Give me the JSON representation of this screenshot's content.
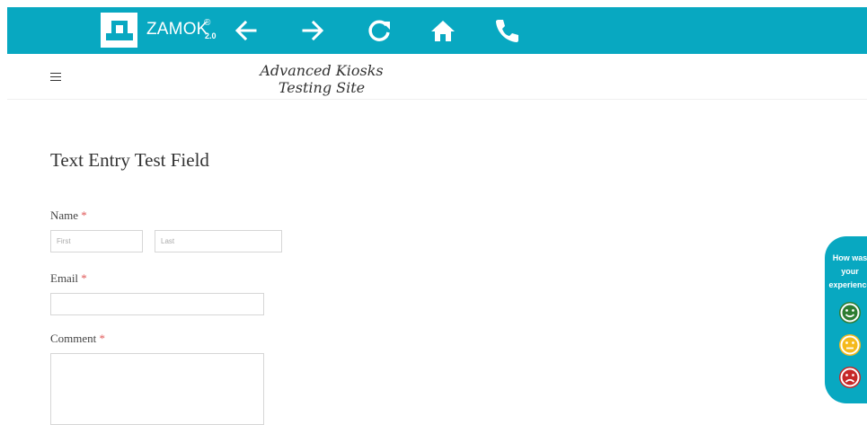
{
  "toolbar": {
    "brand": "ZAMOK",
    "registered": "®",
    "version": "2.0",
    "icons": [
      "back-arrow-icon",
      "forward-arrow-icon",
      "reload-icon",
      "home-icon",
      "phone-icon"
    ],
    "color": "#08a8c1"
  },
  "header": {
    "title_line1": "Advanced Kiosks",
    "title_line2": "Testing Site",
    "menu_icon": "hamburger-menu-icon"
  },
  "form": {
    "heading": "Text Entry Test Field",
    "name_label": "Name",
    "first_placeholder": "First",
    "last_placeholder": "Last",
    "email_label": "Email",
    "comment_label": "Comment",
    "required_mark": "*",
    "required_color": "#e05a5a"
  },
  "feedback": {
    "line1": "How was",
    "line2": "your",
    "line3": "experience",
    "faces": [
      "happy-face-icon",
      "neutral-face-icon",
      "sad-face-icon"
    ],
    "face_colors": [
      "#2e7d32",
      "#f5b91c",
      "#c62828"
    ]
  }
}
